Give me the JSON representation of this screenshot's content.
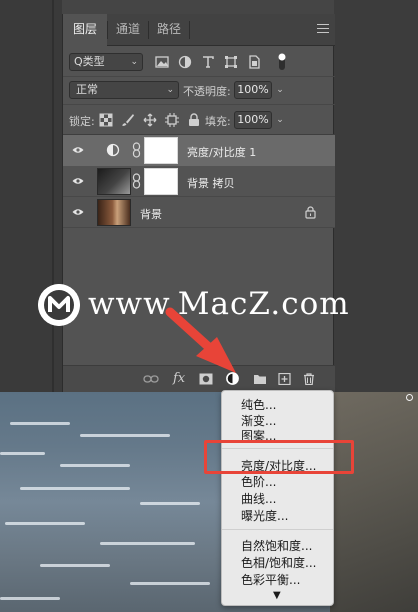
{
  "panel": {
    "tabs": [
      {
        "label": "图层",
        "active": true
      },
      {
        "label": "通道",
        "active": false
      },
      {
        "label": "路径",
        "active": false
      }
    ],
    "filter": {
      "kind_label": "Q类型"
    },
    "blend": {
      "mode": "正常",
      "opacity_label": "不透明度:",
      "opacity_value": "100%"
    },
    "lock": {
      "label": "锁定:",
      "fill_label": "填充:",
      "fill_value": "100%"
    },
    "layers": [
      {
        "name": "亮度/对比度 1",
        "selected": true
      },
      {
        "name": "背景 拷贝",
        "selected": false
      },
      {
        "name": "背景",
        "selected": false
      }
    ],
    "bottom_bar": {
      "fx_label": "fx"
    }
  },
  "menu": {
    "items": [
      "纯色...",
      "渐变...",
      "图案...",
      "亮度/对比度...",
      "色阶...",
      "曲线...",
      "曝光度...",
      "自然饱和度...",
      "色相/饱和度...",
      "色彩平衡..."
    ],
    "more_glyph": "▼"
  },
  "watermark": {
    "text": "www.MacZ.com"
  },
  "colors": {
    "highlight": "#e84438",
    "arrow": "#e84438",
    "panel_bg": "#535353",
    "selected_row": "#6a6a6a"
  }
}
